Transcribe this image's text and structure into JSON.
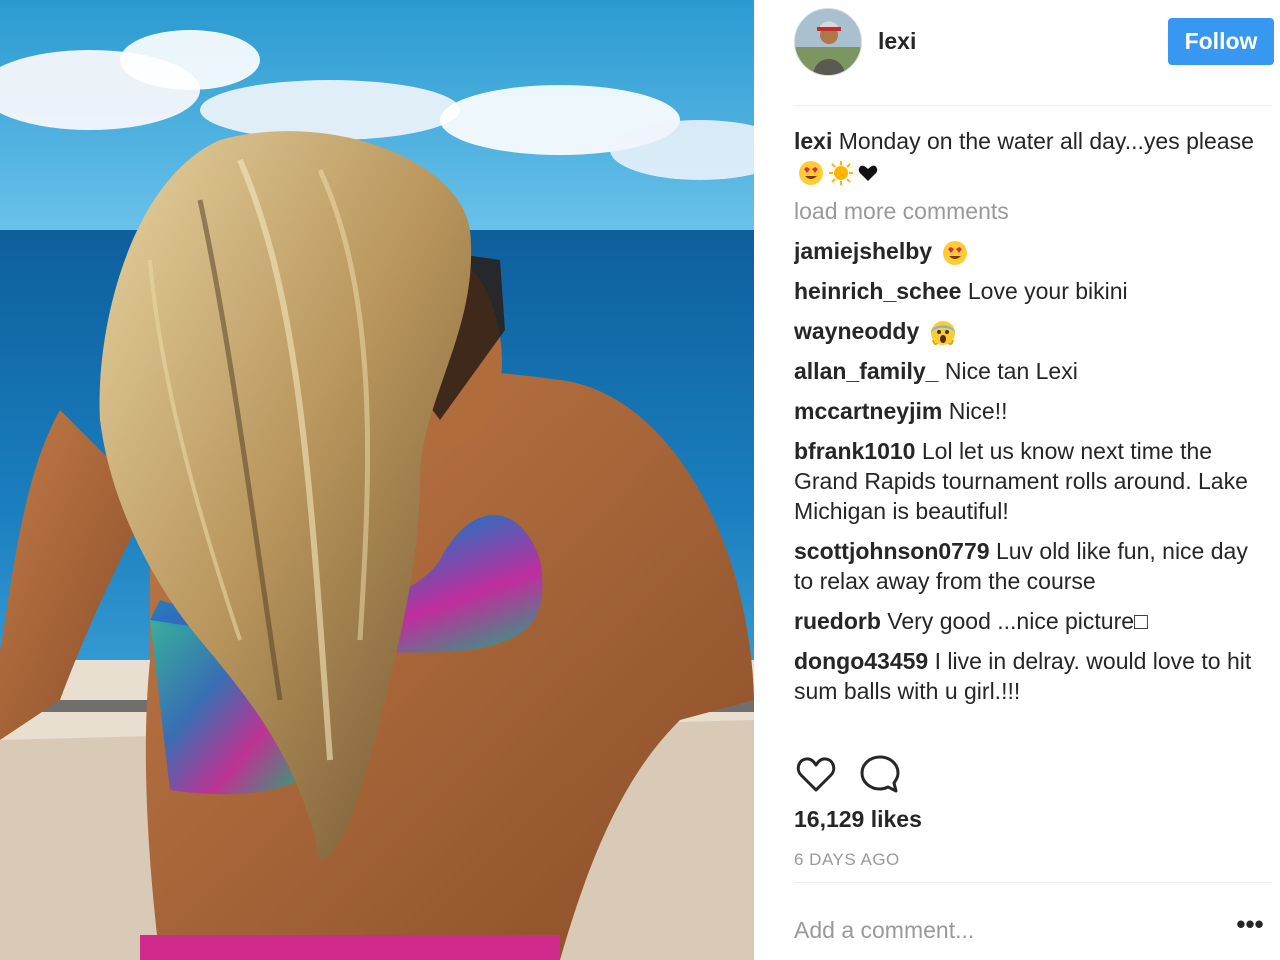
{
  "post": {
    "username": "lexi",
    "follow_label": "Follow",
    "caption_username": "lexi",
    "caption_text": "Monday on the water all day...yes please",
    "load_more": "load more comments",
    "comments": [
      {
        "user": "jamiejshelby",
        "text": ""
      },
      {
        "user": "heinrich_schee",
        "text": "Love your bikini"
      },
      {
        "user": "wayneoddy",
        "text": ""
      },
      {
        "user": "allan_family_",
        "text": "Nice tan Lexi"
      },
      {
        "user": "mccartneyjim",
        "text": "Nice!!"
      },
      {
        "user": "bfrank1010",
        "text": "Lol let us know next time the Grand Rapids tournament rolls around. Lake Michigan is beautiful!"
      },
      {
        "user": "scottjohnson0779",
        "text": "Luv old like fun, nice day to relax away from the course"
      },
      {
        "user": "ruedorb",
        "text": "Very good ...nice picture□"
      },
      {
        "user": "dongo43459",
        "text": "I live in delray. would love to hit sum balls with u girl.!!!"
      }
    ],
    "likes": "16,129 likes",
    "timestamp": "6 DAYS AGO",
    "add_comment_placeholder": "Add a comment...",
    "more_label": "•••"
  },
  "icons": {
    "like": "heart-outline-icon",
    "comment": "speech-bubble-icon",
    "more": "ellipsis-icon"
  },
  "colors": {
    "follow_blue": "#3897f0",
    "muted_text": "#999999",
    "text": "#262626"
  }
}
